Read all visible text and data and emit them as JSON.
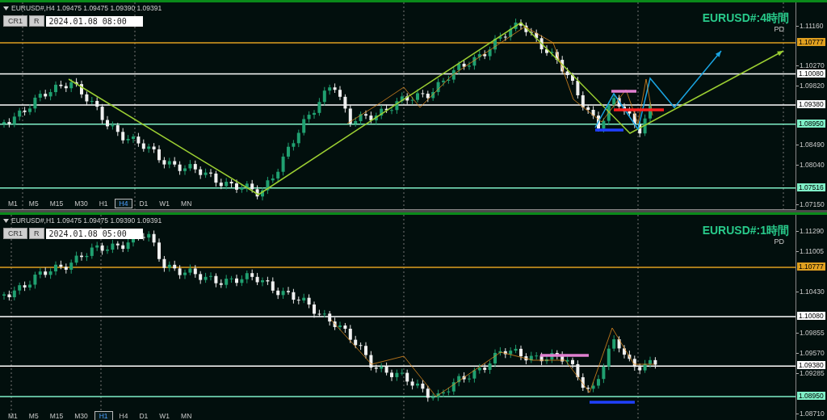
{
  "panels": [
    {
      "symbol_line": "EURUSD#,H4  1.09475 1.09475 1.09390 1.09391",
      "buttons": [
        "CR1",
        "R"
      ],
      "date_field": "2024.01.08 08:00",
      "title": "EURUSD#:4時間",
      "subtitle": "PD",
      "price_ticks": [
        "1.11160",
        "1.10270",
        "1.09820",
        "1.08490",
        "1.08040",
        "1.07150"
      ],
      "levels": [
        {
          "label": "1.10777",
          "color": "#e0a020"
        },
        {
          "label": "1.10080",
          "color": "#ffffff"
        },
        {
          "label": "1.09380",
          "color": "#ffffff"
        },
        {
          "label": "1.08950",
          "color": "#80f0c8"
        },
        {
          "label": "1.07516",
          "color": "#80f0c8"
        }
      ],
      "timeframes": [
        {
          "label": "M1",
          "selected": false
        },
        {
          "label": "M5",
          "selected": false
        },
        {
          "label": "M15",
          "selected": false
        },
        {
          "label": "M30",
          "selected": false
        },
        {
          "label": "H1",
          "selected": false
        },
        {
          "label": "H4",
          "selected": true
        },
        {
          "label": "D1",
          "selected": false
        },
        {
          "label": "W1",
          "selected": false
        },
        {
          "label": "MN",
          "selected": false
        }
      ]
    },
    {
      "symbol_line": "EURUSD#,H1  1.09475 1.09475 1.09390 1.09391",
      "buttons": [
        "CR1",
        "R"
      ],
      "date_field": "2024.01.08 05:00",
      "title": "EURUSD#:1時間",
      "subtitle": "PD",
      "price_ticks": [
        "1.11290",
        "1.11005",
        "1.10430",
        "1.09855",
        "1.09570",
        "1.09285",
        "1.08710"
      ],
      "levels": [
        {
          "label": "1.10777",
          "color": "#e0a020"
        },
        {
          "label": "1.10080",
          "color": "#ffffff"
        },
        {
          "label": "1.09380",
          "color": "#ffffff"
        },
        {
          "label": "1.08950",
          "color": "#80f0c8"
        }
      ],
      "timeframes": [
        {
          "label": "M1",
          "selected": false
        },
        {
          "label": "M5",
          "selected": false
        },
        {
          "label": "M15",
          "selected": false
        },
        {
          "label": "M30",
          "selected": false
        },
        {
          "label": "H1",
          "selected": true
        },
        {
          "label": "H4",
          "selected": false
        },
        {
          "label": "D1",
          "selected": false
        },
        {
          "label": "W1",
          "selected": false
        },
        {
          "label": "MN",
          "selected": false
        }
      ]
    }
  ]
}
